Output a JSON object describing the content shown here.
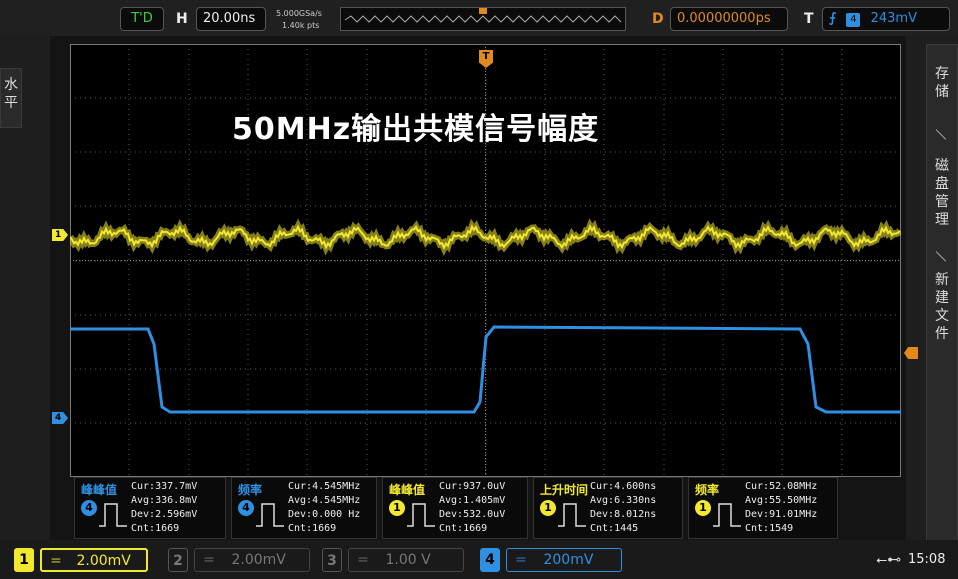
{
  "top": {
    "trig_status": "T'D",
    "h_label": "H",
    "timebase": "20.00ns",
    "sample_rate": "5.000GSa/s",
    "points": "1.40k pts",
    "d_label": "D",
    "delay": "0.00000000ps",
    "t_label": "T",
    "trig_source": "4",
    "trig_level": "243mV"
  },
  "left_menu": {
    "text1": "水",
    "text2": "平"
  },
  "right_menu": {
    "item1": [
      "存",
      "储"
    ],
    "item2": [
      "磁",
      "盘",
      "管",
      "理"
    ],
    "item3": [
      "新",
      "建",
      "文",
      "件"
    ]
  },
  "screen_title": "50MHz输出共模信号幅度",
  "markers": {
    "ch1": "1",
    "ch4": "4",
    "trig_pos": "T"
  },
  "measurements": [
    {
      "name": "峰峰值",
      "channel": "4",
      "cur": "Cur:337.7mV",
      "avg": "Avg:336.8mV",
      "dev": "Dev:2.596mV",
      "cnt": "Cnt:1669"
    },
    {
      "name": "频率",
      "channel": "4",
      "cur": "Cur:4.545MHz",
      "avg": "Avg:4.545MHz",
      "dev": "Dev:0.000 Hz",
      "cnt": "Cnt:1669"
    },
    {
      "name": "峰峰值",
      "channel": "1",
      "cur": "Cur:937.0uV",
      "avg": "Avg:1.405mV",
      "dev": "Dev:532.0uV",
      "cnt": "Cnt:1669"
    },
    {
      "name": "上升时间",
      "channel": "1",
      "cur": "Cur:4.600ns",
      "avg": "Avg:6.330ns",
      "dev": "Dev:8.012ns",
      "cnt": "Cnt:1445"
    },
    {
      "name": "频率",
      "channel": "1",
      "cur": "Cur:52.08MHz",
      "avg": "Avg:55.50MHz",
      "dev": "Dev:91.01MHz",
      "cnt": "Cnt:1549"
    }
  ],
  "channels": [
    {
      "num": "1",
      "scale": "2.00mV"
    },
    {
      "num": "2",
      "scale": "2.00mV"
    },
    {
      "num": "3",
      "scale": "1.00 V"
    },
    {
      "num": "4",
      "scale": "200mV"
    }
  ],
  "status": {
    "time": "15:08"
  },
  "colors": {
    "ch1": "#f2e830",
    "ch4": "#2f8fe0",
    "accent": "#e08a1e"
  }
}
